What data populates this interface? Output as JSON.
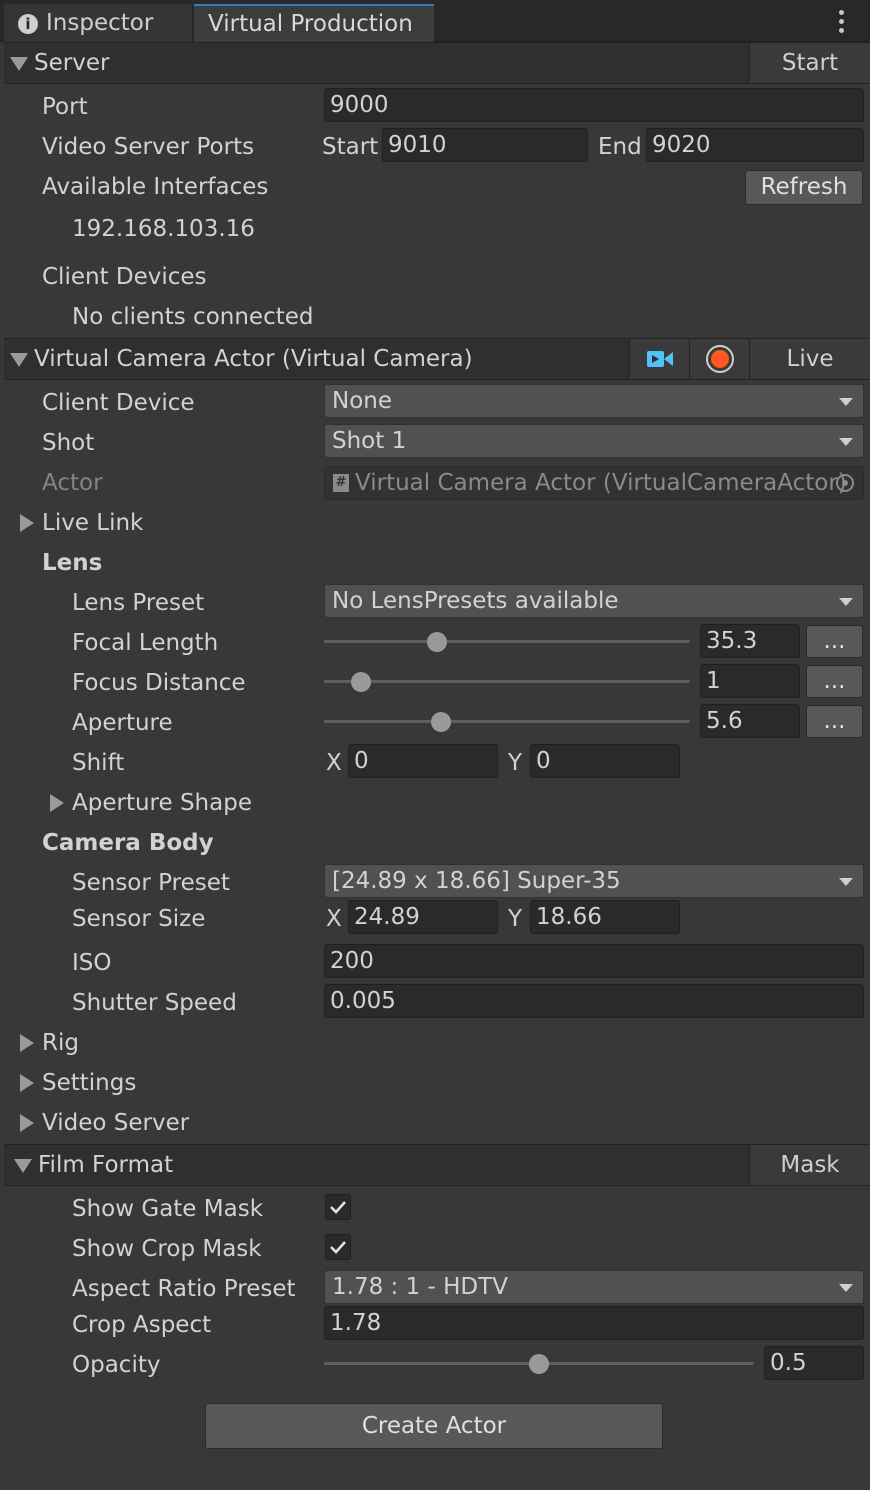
{
  "tabs": {
    "inspector": "Inspector",
    "virtual_production": "Virtual Production"
  },
  "server": {
    "title": "Server",
    "start_button": "Start",
    "port_label": "Port",
    "port_value": "9000",
    "video_ports_label": "Video Server Ports",
    "start_label": "Start",
    "start_value": "9010",
    "end_label": "End",
    "end_value": "9020",
    "interfaces_label": "Available Interfaces",
    "refresh_button": "Refresh",
    "interface_ip": "192.168.103.16",
    "client_devices_label": "Client Devices",
    "no_clients": "No clients connected"
  },
  "vcam": {
    "title": "Virtual Camera Actor (Virtual Camera)",
    "live_button": "Live",
    "client_device_label": "Client Device",
    "client_device_value": "None",
    "shot_label": "Shot",
    "shot_value": "Shot 1",
    "actor_label": "Actor",
    "actor_value": "Virtual Camera Actor (VirtualCameraActor)",
    "live_link_label": "Live Link",
    "lens_label": "Lens",
    "lens_preset_label": "Lens Preset",
    "lens_preset_value": "No LensPresets available",
    "focal_length_label": "Focal Length",
    "focal_length_value": "35.3",
    "focal_length_slider": 0.31,
    "focus_distance_label": "Focus Distance",
    "focus_distance_value": "1",
    "focus_distance_slider": 0.1,
    "aperture_label": "Aperture",
    "aperture_value": "5.6",
    "aperture_slider": 0.32,
    "shift_label": "Shift",
    "shift_x_label": "X",
    "shift_x_value": "0",
    "shift_y_label": "Y",
    "shift_y_value": "0",
    "aperture_shape_label": "Aperture Shape",
    "camera_body_label": "Camera Body",
    "sensor_preset_label": "Sensor Preset",
    "sensor_preset_value": "[24.89 x 18.66] Super-35",
    "sensor_size_label": "Sensor Size",
    "sensor_x_label": "X",
    "sensor_x_value": "24.89",
    "sensor_y_label": "Y",
    "sensor_y_value": "18.66",
    "iso_label": "ISO",
    "iso_value": "200",
    "shutter_label": "Shutter Speed",
    "shutter_value": "0.005",
    "rig_label": "Rig",
    "settings_label": "Settings",
    "video_server_label": "Video Server",
    "more_button": "...",
    "video_icon_color": "#4fc3f7",
    "record_icon_color": "#ff5722"
  },
  "film_format": {
    "title": "Film Format",
    "mask_button": "Mask",
    "show_gate_mask_label": "Show Gate Mask",
    "show_gate_mask": true,
    "show_crop_mask_label": "Show Crop Mask",
    "show_crop_mask": true,
    "aspect_preset_label": "Aspect Ratio Preset",
    "aspect_preset_value": "1.78 : 1 - HDTV",
    "crop_aspect_label": "Crop Aspect",
    "crop_aspect_value": "1.78",
    "opacity_label": "Opacity",
    "opacity_value": "0.5",
    "opacity_slider": 0.5
  },
  "create_actor_button": "Create Actor"
}
